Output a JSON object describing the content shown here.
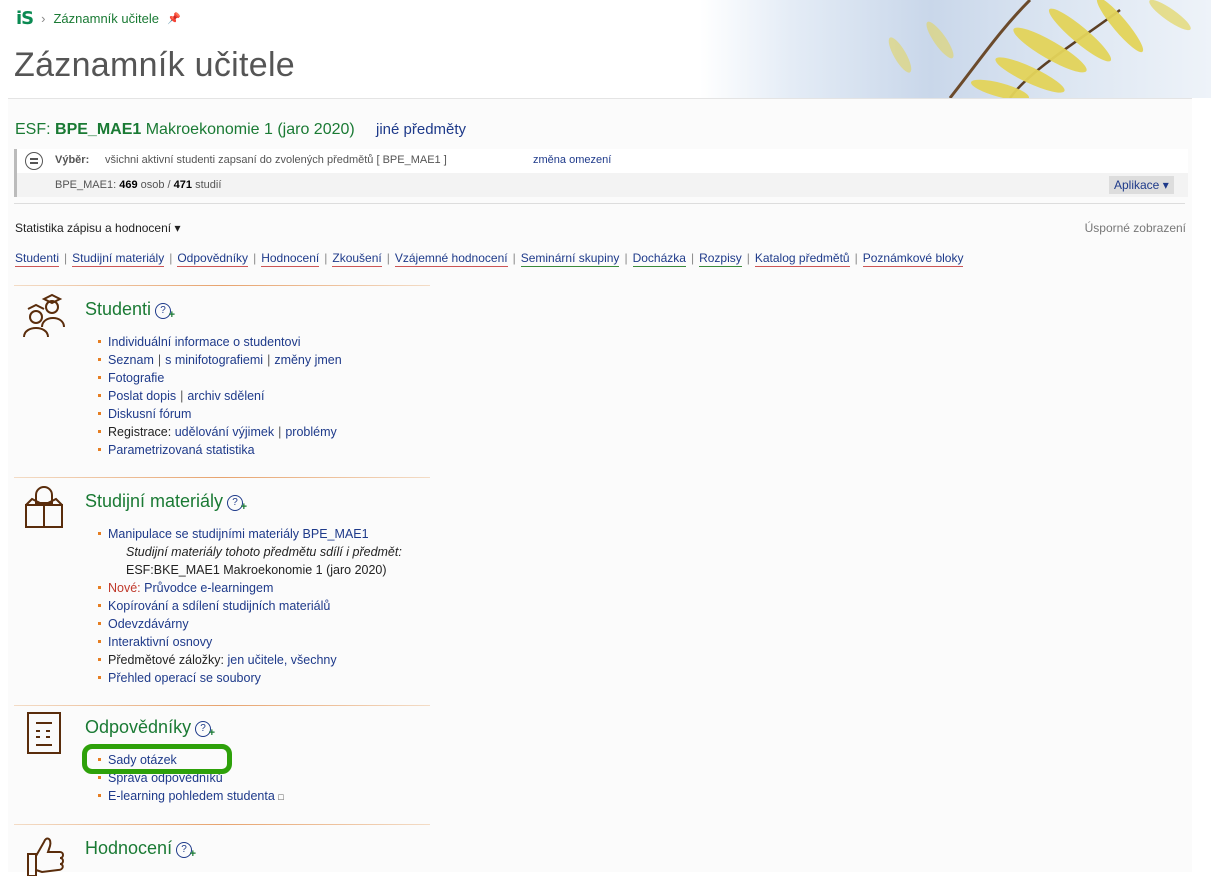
{
  "header": {
    "logo": "iS",
    "breadcrumb": "Záznamník učitele",
    "title": "Záznamník učitele"
  },
  "course": {
    "faculty": "ESF:",
    "code": "BPE_MAE1",
    "name": "Makroekonomie 1 (jaro 2020)",
    "other_link": "jiné předměty"
  },
  "filter": {
    "label": "Výběr:",
    "text": "všichni aktivní studenti zapsaní do zvolených předmětů [ BPE_MAE1 ]",
    "change_link": "změna omezení",
    "stats_prefix": "BPE_MAE1:",
    "persons": "469",
    "persons_word": "osob /",
    "studies": "471",
    "studies_word": "studií",
    "apps_button": "Aplikace"
  },
  "toolbar": {
    "stats_menu": "Statistika zápisu a hodnocení",
    "compact_view": "Úsporné zobrazení"
  },
  "nav": [
    "Studenti",
    "Studijní materiály",
    "Odpovědníky",
    "Hodnocení",
    "Zkoušení",
    "Vzájemné hodnocení",
    "Seminární skupiny",
    "Docházka",
    "Rozpisy",
    "Katalog předmětů",
    "Poznámkové bloky"
  ],
  "sections": {
    "students": {
      "title": "Studenti",
      "items": {
        "individual": "Individuální informace o studentovi",
        "list": "Seznam",
        "minifoto": "s minifotografiemi",
        "name_changes": "změny jmen",
        "photos": "Fotografie",
        "send_mail": "Poslat dopis",
        "archive": "archiv sdělení",
        "forum": "Diskusní fórum",
        "registration": "Registrace:",
        "exceptions": "udělování výjimek",
        "problems": "problémy",
        "param_stats": "Parametrizovaná statistika"
      }
    },
    "materials": {
      "title": "Studijní materiály",
      "items": {
        "manipulation": "Manipulace se studijními materiály BPE_MAE1",
        "shared_note": "Studijní materiály tohoto předmětu sdílí i předmět:",
        "shared_course": "ESF:BKE_MAE1 Makroekonomie 1 (jaro 2020)",
        "new_label": "Nové:",
        "elearning_guide": "Průvodce e-learningem",
        "copy_share": "Kopírování a sdílení studijních materiálů",
        "dropboxes": "Odevzdávárny",
        "syllabus": "Interaktivní osnovy",
        "bookmarks": "Předmětové záložky:",
        "bookmarks_teachers": "jen učitele",
        "bookmarks_all": "všechny",
        "file_ops": "Přehled operací se soubory"
      }
    },
    "quizzes": {
      "title": "Odpovědníky",
      "items": {
        "question_sets": "Sady otázek",
        "quiz_admin": "Správa odpovědníků",
        "student_view": "E-learning pohledem studenta"
      }
    },
    "grading": {
      "title": "Hodnocení"
    }
  },
  "colors": {
    "green_title": "#1a7a34",
    "link_blue": "#1e3a8a",
    "highlight": "#2ea10a",
    "bullet": "#e67e22"
  }
}
